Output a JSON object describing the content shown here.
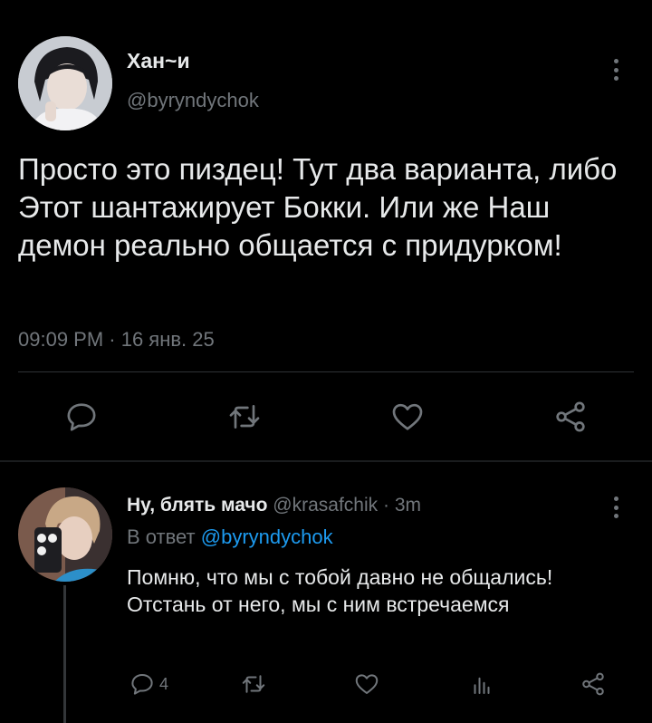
{
  "tweet": {
    "author_name": "Хан~и",
    "author_handle": "@byryndychok",
    "text": "Просто это пиздец! Тут два варианта, либо Этот шантажирует Бокки. Или же Наш демон реально общается с придурком!",
    "timestamp": "09:09 PM · 16 янв. 25",
    "actions": [
      "reply-icon",
      "retweet-icon",
      "like-icon",
      "share-icon"
    ]
  },
  "reply": {
    "author_name": "Ну, блять мачо",
    "author_handle": "@krasafchik",
    "separator": "·",
    "time": "3m",
    "reply_to_prefix": "В ответ",
    "reply_to_handle": "@byryndychok",
    "text": "Помню, что мы с тобой давно не общались! Отстань от него, мы с ним встречаемся",
    "reply_count": "4",
    "actions": [
      "reply-icon",
      "retweet-icon",
      "like-icon",
      "analytics-icon",
      "share-icon"
    ]
  },
  "colors": {
    "background": "#000000",
    "text": "#e7e9ea",
    "muted": "#71767b",
    "link": "#1d9bf0",
    "divider": "#2f3336"
  }
}
